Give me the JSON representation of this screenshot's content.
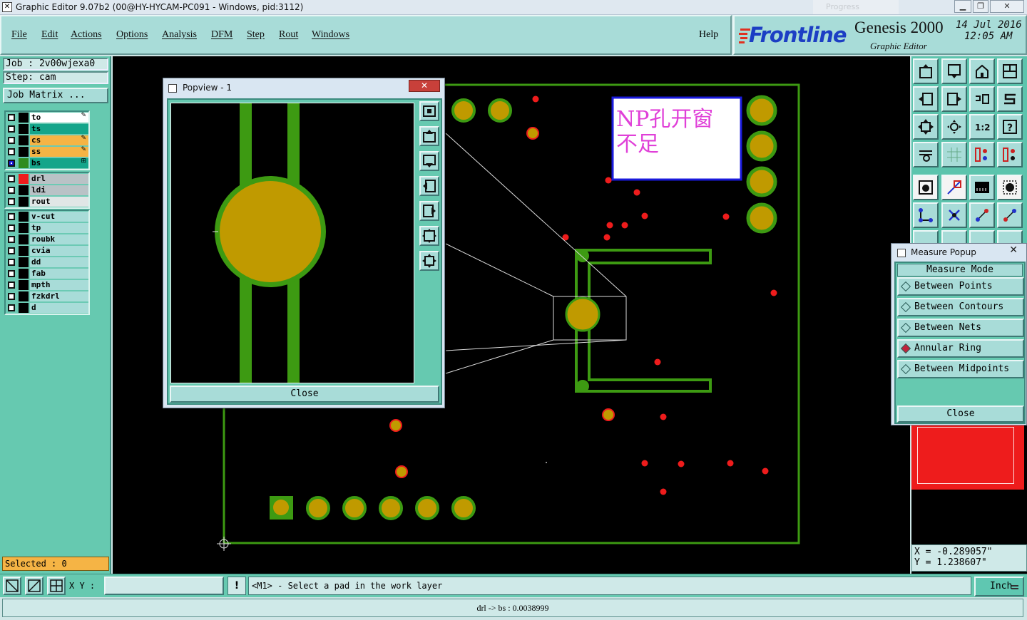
{
  "window": {
    "title": "Graphic Editor 9.07b2 (00@HY-HYCAM-PC091 - Windows, pid:3112)",
    "ghost_label": "Progress"
  },
  "menu": {
    "items": [
      "File",
      "Edit",
      "Actions",
      "Options",
      "Analysis",
      "DFM",
      "Step",
      "Rout",
      "Windows"
    ],
    "help": "Help"
  },
  "logo": {
    "brand": "Frontline",
    "app": "Genesis 2000",
    "subtitle": "Graphic Editor",
    "date": "14 Jul 2016",
    "time": "12:05 AM"
  },
  "job": {
    "job_line": "Job  : 2v00wjexa0",
    "step_line": "Step: cam",
    "matrix_button": "Job Matrix ..."
  },
  "layers": {
    "group1": [
      {
        "name": "to",
        "bg": "#ffffff",
        "swatch": "#000000",
        "mark": "✎"
      },
      {
        "name": "ts",
        "bg": "#14a58a",
        "swatch": "#000000",
        "mark": ""
      },
      {
        "name": "cs",
        "bg": "#f5b445",
        "swatch": "#000000",
        "mark": "✎"
      },
      {
        "name": "ss",
        "bg": "#f5b445",
        "swatch": "#000000",
        "mark": "✎"
      },
      {
        "name": "bs",
        "bg": "#14a58a",
        "swatch": "#2e8b1e",
        "mark": "⊞",
        "active": true
      }
    ],
    "group2": [
      {
        "name": "drl",
        "bg": "#b9c2c6",
        "swatch": "#ee1c1c",
        "mark": ""
      },
      {
        "name": "ldi",
        "bg": "#b9c2c6",
        "swatch": "#000000",
        "mark": ""
      },
      {
        "name": "rout",
        "bg": "#e0e6e6",
        "swatch": "#000000",
        "mark": ""
      }
    ],
    "group3": [
      {
        "name": "v-cut",
        "bg": "#a8dcd8",
        "swatch": "#000000"
      },
      {
        "name": "tp",
        "bg": "#a8dcd8",
        "swatch": "#000000"
      },
      {
        "name": "roubk",
        "bg": "#a8dcd8",
        "swatch": "#000000"
      },
      {
        "name": "cvia",
        "bg": "#a8dcd8",
        "swatch": "#000000"
      },
      {
        "name": "dd",
        "bg": "#a8dcd8",
        "swatch": "#000000"
      },
      {
        "name": "fab",
        "bg": "#a8dcd8",
        "swatch": "#000000"
      },
      {
        "name": "mpth",
        "bg": "#a8dcd8",
        "swatch": "#000000"
      },
      {
        "name": "fzkdrl",
        "bg": "#a8dcd8",
        "swatch": "#000000"
      },
      {
        "name": "d",
        "bg": "#a8dcd8",
        "swatch": "#000000"
      }
    ]
  },
  "selected_label": "Selected : 0",
  "annotation": {
    "line1": "NP孔开窗",
    "line2": "不足"
  },
  "popview": {
    "title": "Popview - 1",
    "close_label": "Close"
  },
  "measure": {
    "title": "Measure Popup",
    "mode_header": "Measure Mode",
    "options": [
      "Between Points",
      "Between Contours",
      "Between Nets",
      "Annular Ring",
      "Between Midpoints"
    ],
    "selected_option": "Annular Ring",
    "close_label": "Close"
  },
  "coords": {
    "x": "X = -0.289057\"",
    "y": "Y = 1.238607\""
  },
  "statusbar": {
    "xy_label": "X Y :",
    "xy_value": "",
    "excl": "!",
    "prompt": "<M1> - Select a pad in the work layer",
    "unit": "Inch"
  },
  "infobar": {
    "text": "drl -> bs : 0.0038999"
  },
  "colors": {
    "copper_green": "#3d9a12",
    "pad_fill": "#c09a00",
    "drill_red": "#ee1c1c",
    "panel_teal": "#66c9b0"
  }
}
